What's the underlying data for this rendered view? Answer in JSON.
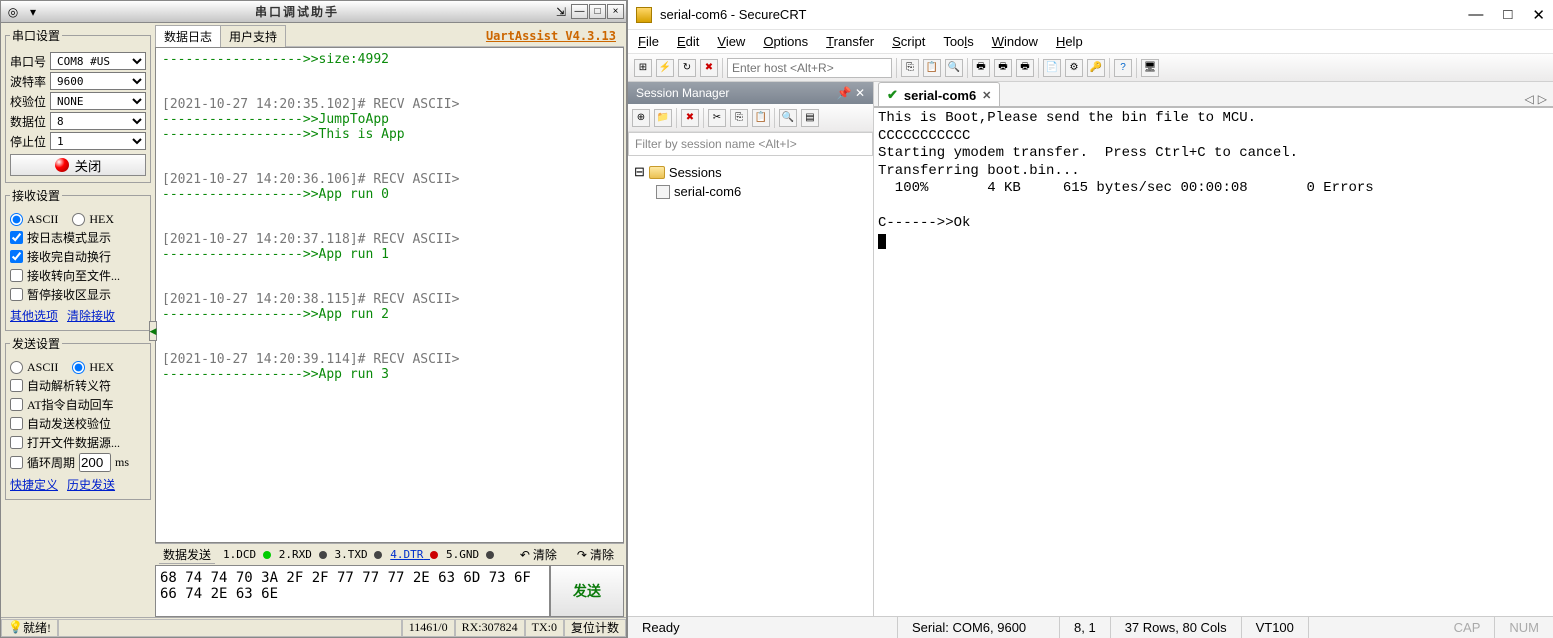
{
  "left": {
    "title": "串口调试助手",
    "port_group": {
      "title": "串口设置",
      "rows": {
        "port": {
          "label": "串口号",
          "value": "COM8 #US"
        },
        "baud": {
          "label": "波特率",
          "value": "9600"
        },
        "parity": {
          "label": "校验位",
          "value": "NONE"
        },
        "data": {
          "label": "数据位",
          "value": "8"
        },
        "stop": {
          "label": "停止位",
          "value": "1"
        }
      },
      "close_btn": "关闭"
    },
    "recv_group": {
      "title": "接收设置",
      "r_ascii": "ASCII",
      "r_hex": "HEX",
      "c_logmode": "按日志模式显示",
      "c_autowrap": "接收完自动换行",
      "c_tofile": "接收转向至文件...",
      "c_pause": "暂停接收区显示",
      "link_other": "其他选项",
      "link_clear": "清除接收"
    },
    "send_group": {
      "title": "发送设置",
      "r_ascii": "ASCII",
      "r_hex": "HEX",
      "c_escape": "自动解析转义符",
      "c_atcr": "AT指令自动回车",
      "c_acheck": "自动发送校验位",
      "c_openfile": "打开文件数据源...",
      "loop_label": "循环周期",
      "loop_val": "200",
      "loop_unit": "ms",
      "link_quick": "快捷定义",
      "link_hist": "历史发送"
    },
    "log_tabs": {
      "active": "数据日志",
      "inactive": "用户支持"
    },
    "version": "UartAssist V4.3.13",
    "log": {
      "l1_g": "------------------>>size:4992",
      "l2_t": "[2021-10-27 14:20:35.102]# RECV ASCII>",
      "l2_g1": "------------------>>JumpToApp",
      "l2_g2": "------------------>>This is App",
      "l3_t": "[2021-10-27 14:20:36.106]# RECV ASCII>",
      "l3_g": "------------------>>App run 0",
      "l4_t": "[2021-10-27 14:20:37.118]# RECV ASCII>",
      "l4_g": "------------------>>App run 1",
      "l5_t": "[2021-10-27 14:20:38.115]# RECV ASCII>",
      "l5_g": "------------------>>App run 2",
      "l6_t": "[2021-10-27 14:20:39.114]# RECV ASCII>",
      "l6_g": "------------------>>App run 3"
    },
    "send_header": {
      "tab": "数据发送",
      "s1": "1.DCD",
      "s2": "2.RXD",
      "s3": "3.TXD",
      "s4": "4.DTR",
      "s5": "5.GND",
      "clear": "清除",
      "clear2": "清除"
    },
    "send_text": "68 74 74 70 3A 2F 2F 77 77 77 2E 63 6D 73 6F\n66 74 2E 63 6E",
    "send_btn": "发送",
    "status": {
      "ready": "就绪!",
      "c1": "11461/0",
      "c2": "RX:307824",
      "c3": "TX:0",
      "c4": "复位计数"
    }
  },
  "right": {
    "title": "serial-com6 - SecureCRT",
    "menu": [
      "File",
      "Edit",
      "View",
      "Options",
      "Transfer",
      "Script",
      "Tools",
      "Window",
      "Help"
    ],
    "enter_host": "Enter host <Alt+R>",
    "session_mgr": {
      "title": "Session Manager",
      "filter": "Filter by session name <Alt+I>",
      "root": "Sessions",
      "item": "serial-com6"
    },
    "tab": {
      "name": "serial-com6"
    },
    "terminal": "This is Boot,Please send the bin file to MCU.\nCCCCCCCCCCC\nStarting ymodem transfer.  Press Ctrl+C to cancel.\nTransferring boot.bin...\n  100%       4 KB     615 bytes/sec 00:00:08       0 Errors\n\nC------>>Ok",
    "status": {
      "ready": "Ready",
      "serial": "Serial: COM6, 9600",
      "pos": "8,  1",
      "dim": "37 Rows, 80 Cols",
      "emul": "VT100",
      "cap": "CAP",
      "num": "NUM"
    }
  }
}
